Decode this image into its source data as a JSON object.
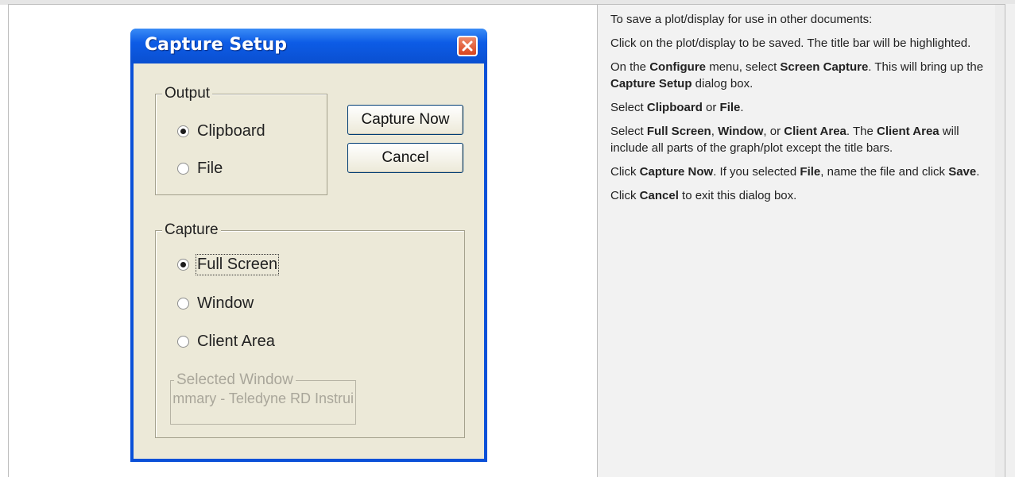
{
  "dialog": {
    "title": "Capture Setup",
    "output_group": {
      "legend": "Output",
      "options": [
        "Clipboard",
        "File"
      ],
      "selected": "Clipboard"
    },
    "capture_now_label": "Capture Now",
    "cancel_label": "Cancel",
    "capture_group": {
      "legend": "Capture",
      "options": [
        "Full Screen",
        "Window",
        "Client Area"
      ],
      "selected": "Full Screen"
    },
    "selected_window": {
      "legend": "Selected Window",
      "value": "iarge Summary - Teledyne RD Instrui"
    }
  },
  "instructions": {
    "intro": "To save a plot/display for use in other documents:",
    "step1": "Click on the plot/display to be saved. The title bar will be highlighted.",
    "step2": {
      "t1": "On the ",
      "b1": "Configure",
      "t2": " menu, select ",
      "b2": "Screen Capture",
      "t3": ". This will bring up the ",
      "b3": "Capture Setup",
      "t4": " dialog box."
    },
    "step3": {
      "t1": "Select ",
      "b1": "Clipboard",
      "t2": " or ",
      "b2": "File",
      "t3": "."
    },
    "step4": {
      "t1": "Select ",
      "b1": "Full Screen",
      "t2": ", ",
      "b2": "Window",
      "t3": ", or ",
      "b3": "Client Area",
      "t4": ". The ",
      "b4": "Client Area",
      "t5": " will include all parts of the graph/plot except the title bars."
    },
    "step5": {
      "t1": "Click ",
      "b1": "Capture Now",
      "t2": ". If you selected ",
      "b2": "File",
      "t3": ", name the file and click ",
      "b3": "Save",
      "t4": "."
    },
    "step6": {
      "t1": "Click ",
      "b1": "Cancel",
      "t2": " to exit this dialog box."
    }
  }
}
